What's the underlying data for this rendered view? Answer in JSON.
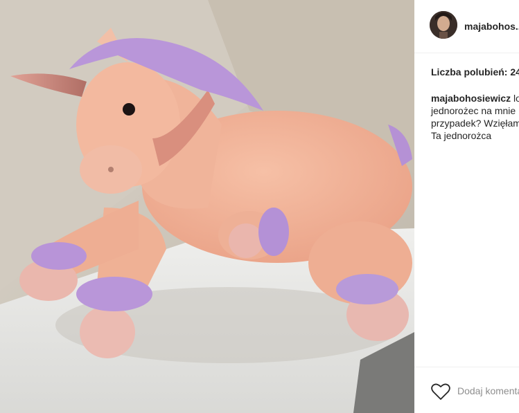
{
  "post": {
    "username": "majabohos...",
    "likes_label": "Liczba polubień: 24",
    "caption_username": "majabohosiewicz",
    "caption_lines": [
      " lo",
      "jednorożec na mnie",
      "przypadek? Wzięłam",
      "Ta jednorożca"
    ],
    "add_comment_placeholder": "Dodaj komentarz..."
  },
  "icons": {
    "heart": "heart-icon",
    "avatar": "user-avatar"
  },
  "colors": {
    "unicorn_body": "#f2b49a",
    "mane": "#b592d6",
    "horn": "#cf8a7e"
  }
}
